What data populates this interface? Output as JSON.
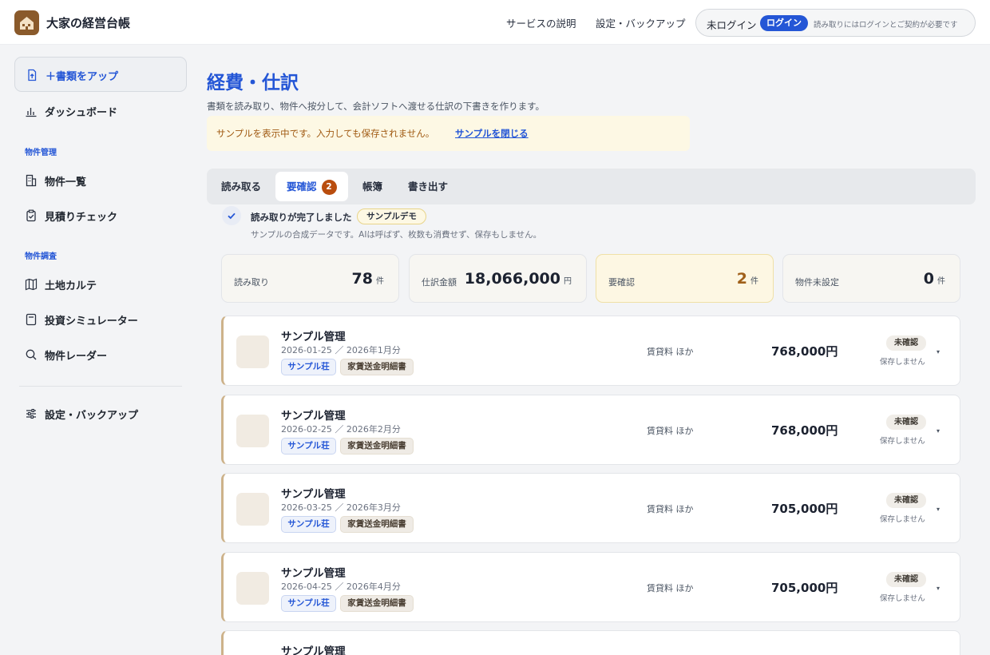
{
  "header": {
    "app_title": "大家の経営台帳",
    "nav": [
      "サービスの説明",
      "設定・バックアップ"
    ],
    "login_status": "未ログイン",
    "login_button": "ログイン",
    "login_note": "読み取りにはログインとご契約が必要です"
  },
  "sidebar": {
    "upload": "＋書類をアップ",
    "dashboard": "ダッシュボード",
    "heading_property_mgmt": "物件管理",
    "property_list": "物件一覧",
    "estimate_check": "見積りチェック",
    "heading_property_survey": "物件調査",
    "land_karte": "土地カルテ",
    "investment_sim": "投資シミュレーター",
    "property_radar": "物件レーダー",
    "settings": "設定・バックアップ"
  },
  "main": {
    "title": "経費・仕訳",
    "description": "書類を読み取り、物件へ按分して、会計ソフトへ渡せる仕訳の下書きを作ります。",
    "notice_text": "サンプルを表示中です。入力しても保存されません。",
    "notice_link": "サンプルを閉じる",
    "tabs": [
      "読み取る",
      "要確認",
      "帳簿",
      "書き出す"
    ],
    "tab_badge": "2",
    "done_text": "読み取りが完了しました",
    "demo_pill": "サンプルデモ",
    "done_sub": "サンプルの合成データです。AIは呼ばず、枚数も消費せず、保存もしません。",
    "stats": [
      {
        "label": "読み取り",
        "value": "78",
        "unit": "件"
      },
      {
        "label": "仕訳金額",
        "value": "18,066,000",
        "unit": "円"
      },
      {
        "label": "要確認",
        "value": "2",
        "unit": "件"
      },
      {
        "label": "物件未設定",
        "value": "0",
        "unit": "件"
      }
    ],
    "rows": [
      {
        "title": "サンプル管理",
        "date": "2026-01-25 ／ 2026年1月分",
        "tag_property": "サンプル荘",
        "tag_doc": "家賃送金明細書",
        "category": "賃貸料 ほか",
        "amount": "768,000円",
        "status": "未確認",
        "status_note": "保存しません"
      },
      {
        "title": "サンプル管理",
        "date": "2026-02-25 ／ 2026年2月分",
        "tag_property": "サンプル荘",
        "tag_doc": "家賃送金明細書",
        "category": "賃貸料 ほか",
        "amount": "768,000円",
        "status": "未確認",
        "status_note": "保存しません"
      },
      {
        "title": "サンプル管理",
        "date": "2026-03-25 ／ 2026年3月分",
        "tag_property": "サンプル荘",
        "tag_doc": "家賃送金明細書",
        "category": "賃貸料 ほか",
        "amount": "705,000円",
        "status": "未確認",
        "status_note": "保存しません"
      },
      {
        "title": "サンプル管理",
        "date": "2026-04-25 ／ 2026年4月分",
        "tag_property": "サンプル荘",
        "tag_doc": "家賃送金明細書",
        "category": "賃貸料 ほか",
        "amount": "705,000円",
        "status": "未確認",
        "status_note": "保存しません"
      },
      {
        "title": "サンプル管理"
      }
    ],
    "caret": "▾"
  },
  "colors": {
    "accent": "#2456d6",
    "warning_badge": "#b94d0e",
    "row_border": "#cdb28a"
  }
}
